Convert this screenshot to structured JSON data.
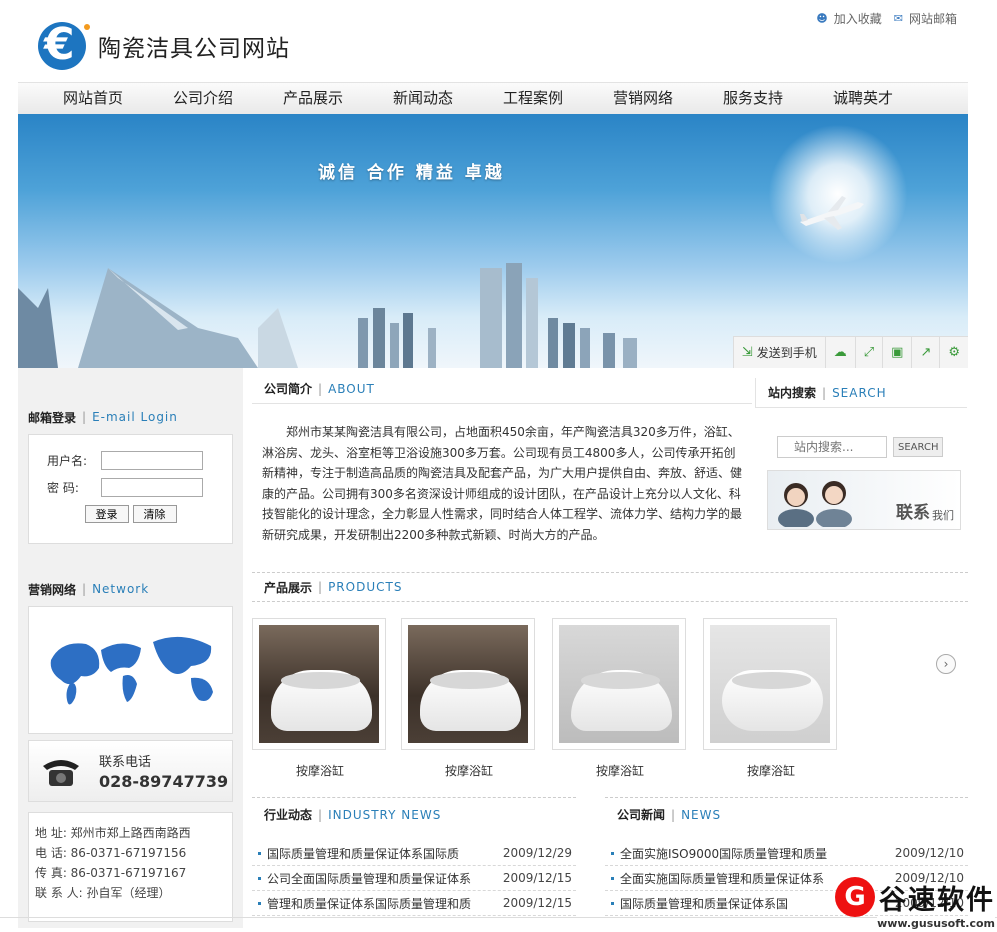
{
  "header": {
    "title": "陶瓷洁具公司网站",
    "top_links": [
      {
        "label": "加入收藏",
        "icon": "user-icon"
      },
      {
        "label": "网站邮箱",
        "icon": "mail-icon"
      }
    ]
  },
  "nav": [
    "网站首页",
    "公司介绍",
    "产品展示",
    "新闻动态",
    "工程案例",
    "营销网络",
    "服务支持",
    "诚聘英才"
  ],
  "banner": {
    "slogan": "诚信  合作  精益  卓越",
    "share": {
      "send_label": "发送到手机"
    }
  },
  "login": {
    "title": "邮箱登录",
    "title_en": "E-mail Login",
    "username_label": "用户名:",
    "password_label": "密  码:",
    "login_button": "登录",
    "clear_button": "清除"
  },
  "network": {
    "title": "营销网络",
    "title_en": "Network",
    "phone_label": "联系电话",
    "phone": "028-89747739"
  },
  "contact": {
    "address": "地  址:  郑州市郑上路西南路西",
    "tel": "电  话:  86-0371-67197156",
    "fax": "传  真:  86-0371-67197167",
    "person": "联 系 人:  孙自军（经理）"
  },
  "about": {
    "title": "公司简介",
    "title_en": "ABOUT",
    "text": "郑州市某某陶瓷洁具有限公司，占地面积450余亩，年产陶瓷洁具320多万件，浴缸、淋浴房、龙头、浴室柜等卫浴设施300多万套。公司现有员工4800多人，公司传承开拓创新精神，专注于制造高品质的陶瓷洁具及配套产品，为广大用户提供自由、奔放、舒适、健康的产品。公司拥有300多名资深设计师组成的设计团队，在产品设计上充分以人文化、科技智能化的设计理念，全力彰显人性需求，同时结合人体工程学、流体力学、结构力学的最新研究成果，开发研制出2200多种款式新颖、时尚大方的产品。"
  },
  "search": {
    "title": "站内搜索",
    "title_en": "SEARCH",
    "placeholder": "站内搜索...",
    "button": "SEARCH",
    "contact_us": "联系",
    "contact_us_sub": "我们"
  },
  "products": {
    "title": "产品展示",
    "title_en": "PRODUCTS",
    "items": [
      "按摩浴缸",
      "按摩浴缸",
      "按摩浴缸",
      "按摩浴缸"
    ]
  },
  "industry_news": {
    "title": "行业动态",
    "title_en": "INDUSTRY NEWS",
    "items": [
      {
        "title": "国际质量管理和质量保证体系国际质",
        "date": "2009/12/29"
      },
      {
        "title": "公司全面国际质量管理和质量保证体系",
        "date": "2009/12/15"
      },
      {
        "title": "管理和质量保证体系国际质量管理和质",
        "date": "2009/12/15"
      }
    ]
  },
  "company_news": {
    "title": "公司新闻",
    "title_en": "NEWS",
    "items": [
      {
        "title": "全面实施ISO9000国际质量管理和质量",
        "date": "2009/12/10"
      },
      {
        "title": "全面实施国际质量管理和质量保证体系",
        "date": "2009/12/10"
      },
      {
        "title": "国际质量管理和质量保证体系国",
        "date": "2009/12/10"
      }
    ]
  },
  "watermark": {
    "name": "谷速软件",
    "url": "www.gususoft.com"
  },
  "colors": {
    "accent": "#2a7fb8",
    "logo_blue": "#1d75c0",
    "logo_orange": "#f39a1e"
  }
}
